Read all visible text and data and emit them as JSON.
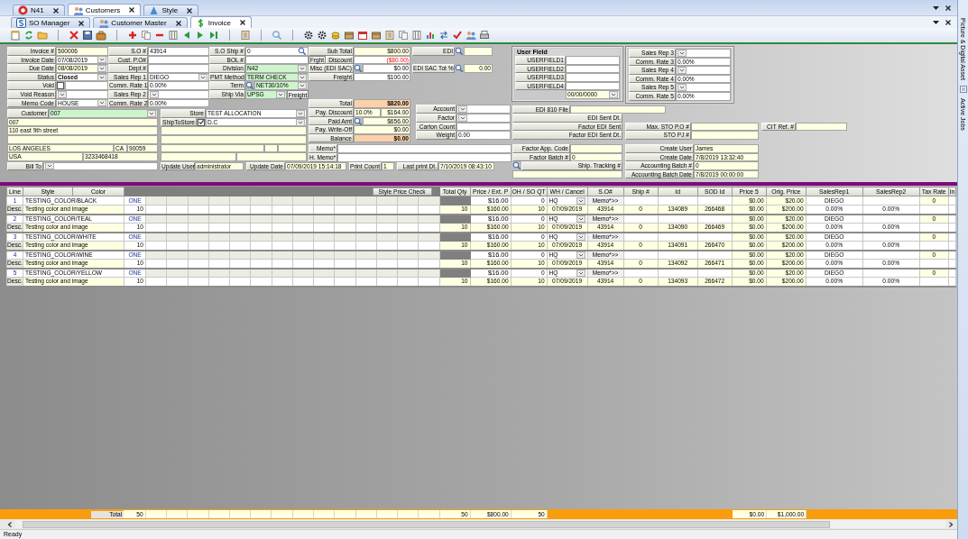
{
  "module_tabs": [
    {
      "label": "N41",
      "selected": false
    },
    {
      "label": "Customers",
      "selected": true
    },
    {
      "label": "Style",
      "selected": false
    }
  ],
  "document_tabs": [
    {
      "label": "SO Manager",
      "selected": false
    },
    {
      "label": "Customer Master",
      "selected": false
    },
    {
      "label": "Invoice",
      "selected": true
    }
  ],
  "form": {
    "main": {
      "rows": [
        {
          "label": "Invoice #",
          "value": "500006",
          "color": "#ffffe1"
        },
        {
          "label": "Invoice Date",
          "value": "07/08/2019",
          "kind": "dropdown"
        },
        {
          "label": "Due Date",
          "value": "08/08/2019",
          "kind": "dropdown",
          "color": "#ffffe1"
        },
        {
          "label": "Status",
          "value": "Closed",
          "kind": "dropdown",
          "bold": true
        },
        {
          "label": "Void",
          "kind": "check",
          "checked": false
        },
        {
          "label": "Void Reason",
          "kind": "dropdown"
        },
        {
          "label": "Memo Code",
          "value": "HOUSE",
          "kind": "dropdown"
        }
      ]
    },
    "order": {
      "rows": [
        {
          "label": "S.O #",
          "value": "43914"
        },
        {
          "label": "Cust. P.O#"
        },
        {
          "label": "Dept #"
        },
        {
          "label": "Sales Rep 1",
          "value": "DIEGO",
          "kind": "dropdown"
        },
        {
          "label": "Comm. Rate 1",
          "value": "0.00%"
        },
        {
          "label": "Sales Rep 2",
          "kind": "dropdown"
        },
        {
          "label": "Comm. Rate 2",
          "value": "0.00%"
        }
      ]
    },
    "shipping": {
      "rows": [
        {
          "label": "S.O Ship #",
          "value": "0",
          "kind": "search"
        },
        {
          "label": "BOL #"
        },
        {
          "label": "Division",
          "value": "N42",
          "kind": "dropdown",
          "color": "#ccf5cc"
        },
        {
          "label": "PMT Method",
          "value": "TERM CHECK",
          "kind": "dropdown",
          "color": "#ccf5cc"
        },
        {
          "label": "Term",
          "value": "NET30/10%",
          "kind": "lookup-dropdown",
          "color": "#ccf5cc"
        },
        {
          "label": "Ship Via",
          "value": "UPSG",
          "kind": "dropdown",
          "color": "#ccf5cc",
          "tail_button": "Freight"
        }
      ]
    },
    "totals": {
      "rows": [
        {
          "label": "Sub Total",
          "value": "$800.00",
          "color": "#ffffe1"
        },
        {
          "label": "Discount",
          "value": "($80.00)",
          "negative": true,
          "lead_button": "Frght"
        },
        {
          "label": "Misc (EDI SAC)",
          "value": "$0.00",
          "kind": "lookup"
        },
        {
          "label": "Freight",
          "value": "$100.00"
        }
      ]
    },
    "edi": {
      "rows": [
        {
          "label": "EDI",
          "kind": "lookup",
          "color": "#ffffe1"
        },
        {
          "label": "EDI SAC Tot %",
          "value": "0.00",
          "kind": "lookup",
          "color": "#ffffe1"
        }
      ]
    },
    "payment": {
      "rows": [
        {
          "label": "Total",
          "value": "$820.00",
          "color": "#fcd0a8",
          "bold": true
        },
        {
          "label": "Pay. Discount",
          "rate": "10.0%",
          "value": "$164.00",
          "color": "#ffffe1"
        },
        {
          "label": "Paid Amt",
          "value": "$656.00",
          "kind": "lookup",
          "color": "#ffffe1"
        },
        {
          "label": "Pay. Write-Off",
          "value": "$0.00",
          "color": "#ffffe1"
        },
        {
          "label": "Balance",
          "value": "$0.00",
          "color": "#fcd0a8",
          "bold": true
        }
      ]
    },
    "account": {
      "rows": [
        {
          "label": "Account",
          "kind": "dropdown"
        },
        {
          "label": "Factor",
          "kind": "dropdown"
        },
        {
          "label": "Carton Count"
        },
        {
          "label": "Weight",
          "value": "0.00"
        }
      ]
    },
    "memo": {
      "rows": [
        {
          "label": "Memo*"
        },
        {
          "label": "H. Memo*"
        }
      ]
    },
    "customer": {
      "rows": [
        {
          "label": "Customer",
          "value": "007",
          "kind": "dropdown",
          "color": "#ccf5cc"
        }
      ],
      "address": [
        {
          "cells": [
            {
              "value": "007"
            }
          ]
        },
        {
          "cells": [
            {
              "value": "110 east 9th street"
            }
          ]
        },
        {
          "cells": [
            {}
          ]
        },
        {
          "cells": [
            {
              "value": "LOS ANGELES"
            },
            {
              "value": "CA"
            },
            {
              "value": "90059"
            }
          ]
        },
        {
          "cells": [
            {
              "value": "USA"
            },
            {
              "value": "3233468418"
            }
          ]
        }
      ]
    },
    "store": {
      "rows": [
        {
          "label": "Store",
          "value": "TEST ALLOCATION",
          "kind": "dropdown"
        },
        {
          "label": "ShipToStore",
          "value": "D.C",
          "kind": "check-dropdown",
          "checked": true
        }
      ]
    },
    "bill_to": {
      "rows": [
        {
          "label": "Bill To",
          "kind": "dropdown"
        }
      ]
    },
    "update": {
      "rows": [
        {
          "label": "Update User",
          "value": "administrator",
          "color": "#ffffe1"
        },
        {
          "label": "Update Date",
          "value": "07/09/2019 15:14:18",
          "color": "#ffffe1"
        },
        {
          "label": "Print Count",
          "value": "1",
          "color": "#ffffe1"
        },
        {
          "label": "Last print Dt.",
          "value": "7/10/2019 08:43:10",
          "color": "#ffffe1"
        }
      ]
    },
    "user_field": {
      "title": "User Field",
      "rows": [
        {
          "label": "USERFIELD1"
        },
        {
          "label": "USERFIELD2"
        },
        {
          "label": "USERFIELD3"
        },
        {
          "label": "USERFIELD4"
        },
        {
          "value": "00/00/0000",
          "kind": "dropdown",
          "color": "#ffffe1"
        }
      ]
    },
    "sales_reps": {
      "rows": [
        {
          "label": "Sales Rep 3",
          "kind": "dropdown"
        },
        {
          "label": "Comm. Rate 3",
          "value": "0.00%"
        },
        {
          "label": "Sales Rep 4",
          "kind": "dropdown"
        },
        {
          "label": "Comm. Rate 4",
          "value": "0.00%"
        },
        {
          "label": "Sales Rep 5",
          "kind": "dropdown"
        },
        {
          "label": "Comm. Rate 5",
          "value": "0.00%"
        }
      ]
    },
    "edi_file": {
      "rows": [
        {
          "label": "EDI 810 File",
          "color": "#ffffe1"
        }
      ]
    },
    "edi_status": {
      "rows": [
        {
          "label": "EDI Sent Dt.",
          "kind": "label"
        },
        {
          "label": "Factor EDI Sent",
          "kind": "label"
        },
        {
          "label": "Factor EDI Sent Dt.",
          "kind": "label"
        }
      ]
    },
    "factor": {
      "rows": [
        {
          "label": "Factor App. Code",
          "color": "#ffffe1"
        },
        {
          "label": "Factor Batch #",
          "value": "0",
          "color": "#ffffe1"
        },
        {
          "label": "Ship. Tracking #",
          "kind": "lookup-label"
        },
        {
          "color": "#ffffe1"
        }
      ]
    },
    "sto": {
      "rows": [
        {
          "label": "Max. STO P.O #",
          "color": "#ffffe1"
        },
        {
          "label": "STO PJ #",
          "color": "#ffffe1"
        }
      ]
    },
    "create": {
      "rows": [
        {
          "label": "Create User",
          "value": "James",
          "color": "#ffffe1"
        },
        {
          "label": "Create Date",
          "value": "7/8/2019 13:32:40",
          "color": "#ffffe1"
        },
        {
          "label": "Accounting Batch #",
          "value": "0",
          "color": "#ffffe1"
        },
        {
          "label": "Accounting Batch Date",
          "value": "7/8/2019 00:00:00",
          "color": "#ffffe1"
        }
      ]
    },
    "cit": {
      "rows": [
        {
          "label": "CIT Ref. #",
          "color": "#ffffe1"
        }
      ]
    }
  },
  "grid": {
    "left_columns": [
      {
        "label": "Line"
      },
      {
        "label": "Style"
      },
      {
        "label": "Color"
      }
    ],
    "price_check_button": "Style Price Check",
    "columns": [
      {
        "label": "Total Qty"
      },
      {
        "label": "Price / Ext. P"
      },
      {
        "label": "OH / SO QT"
      },
      {
        "label": "WH / Cancel"
      },
      {
        "label": "S.O#"
      },
      {
        "label": "Ship #"
      },
      {
        "label": "Id"
      },
      {
        "label": "SOD Id"
      },
      {
        "label": "Price 5"
      },
      {
        "label": "Orig. Price"
      },
      {
        "label": "SalesRep1"
      },
      {
        "label": "SalesRep2"
      },
      {
        "label": "Tax Rate"
      },
      {
        "label": "In"
      }
    ],
    "rows": [
      {
        "line": "1",
        "style": "TESTING_COLOR/BLACK",
        "size": "ONE",
        "price": "$16.00",
        "oh": "0",
        "wh": "HQ",
        "memo": "Memo*>>",
        "price5": "$0.00",
        "orig_price": "$20.00",
        "salesrep1": "DIEGO",
        "tax_rate": "0",
        "desc_label": "Desc.",
        "desc": "Testing color and image",
        "qty": "10",
        "total_qty": "10",
        "ext_price": "$160.00",
        "so_qty": "10",
        "cancel_date": "07/09/2019",
        "so": "43914",
        "ship": "0",
        "id": "134089",
        "sod_id": "266468",
        "price5_ext": "$0.00",
        "orig_ext": "$200.00",
        "comm1": "0.00%",
        "comm2": "0.00%"
      },
      {
        "line": "2",
        "style": "TESTING_COLOR/TEAL",
        "size": "ONE",
        "price": "$16.00",
        "oh": "0",
        "wh": "HQ",
        "memo": "Memo*>>",
        "price5": "$0.00",
        "orig_price": "$20.00",
        "salesrep1": "DIEGO",
        "tax_rate": "0",
        "desc_label": "Desc.",
        "desc": "Testing color and image",
        "qty": "10",
        "total_qty": "10",
        "ext_price": "$160.00",
        "so_qty": "10",
        "cancel_date": "07/09/2019",
        "so": "43914",
        "ship": "0",
        "id": "134090",
        "sod_id": "266469",
        "price5_ext": "$0.00",
        "orig_ext": "$200.00",
        "comm1": "0.00%",
        "comm2": "0.00%"
      },
      {
        "line": "3",
        "style": "TESTING_COLOR/WHITE",
        "size": "ONE",
        "price": "$16.00",
        "oh": "0",
        "wh": "HQ",
        "memo": "Memo*>>",
        "price5": "$0.00",
        "orig_price": "$20.00",
        "salesrep1": "DIEGO",
        "tax_rate": "0",
        "desc_label": "Desc.",
        "desc": "Testing color and image",
        "qty": "10",
        "total_qty": "10",
        "ext_price": "$160.00",
        "so_qty": "10",
        "cancel_date": "07/09/2019",
        "so": "43914",
        "ship": "0",
        "id": "134091",
        "sod_id": "266470",
        "price5_ext": "$0.00",
        "orig_ext": "$200.00",
        "comm1": "0.00%",
        "comm2": "0.00%"
      },
      {
        "line": "4",
        "style": "TESTING_COLOR/WINE",
        "size": "ONE",
        "price": "$16.00",
        "oh": "0",
        "wh": "HQ",
        "memo": "Memo*>>",
        "price5": "$0.00",
        "orig_price": "$20.00",
        "salesrep1": "DIEGO",
        "tax_rate": "0",
        "desc_label": "Desc.",
        "desc": "Testing color and image",
        "qty": "10",
        "total_qty": "10",
        "ext_price": "$160.00",
        "so_qty": "10",
        "cancel_date": "07/09/2019",
        "so": "43914",
        "ship": "0",
        "id": "134092",
        "sod_id": "266471",
        "price5_ext": "$0.00",
        "orig_ext": "$200.00",
        "comm1": "0.00%",
        "comm2": "0.00%"
      },
      {
        "line": "5",
        "style": "TESTING_COLOR/YELLOW",
        "size": "ONE",
        "price": "$16.00",
        "oh": "0",
        "wh": "HQ",
        "memo": "Memo*>>",
        "price5": "$0.00",
        "orig_price": "$20.00",
        "salesrep1": "DIEGO",
        "tax_rate": "0",
        "desc_label": "Desc.",
        "desc": "Testing color and image",
        "qty": "10",
        "total_qty": "10",
        "ext_price": "$160.00",
        "so_qty": "10",
        "cancel_date": "07/09/2019",
        "so": "43914",
        "ship": "0",
        "id": "134093",
        "sod_id": "266472",
        "price5_ext": "$0.00",
        "orig_ext": "$200.00",
        "comm1": "0.00%",
        "comm2": "0.00%"
      }
    ],
    "totals": {
      "label": "Total",
      "size_qty": "50",
      "total_qty": "50",
      "ext_price": "$800.00",
      "so_qty": "50",
      "price5": "$0.00",
      "orig_price": "$1,000.00"
    }
  },
  "side_panels": [
    {
      "label": "Picture & Digital Asset"
    },
    {
      "label": "Active Jobs"
    }
  ],
  "status_bar": "Ready"
}
